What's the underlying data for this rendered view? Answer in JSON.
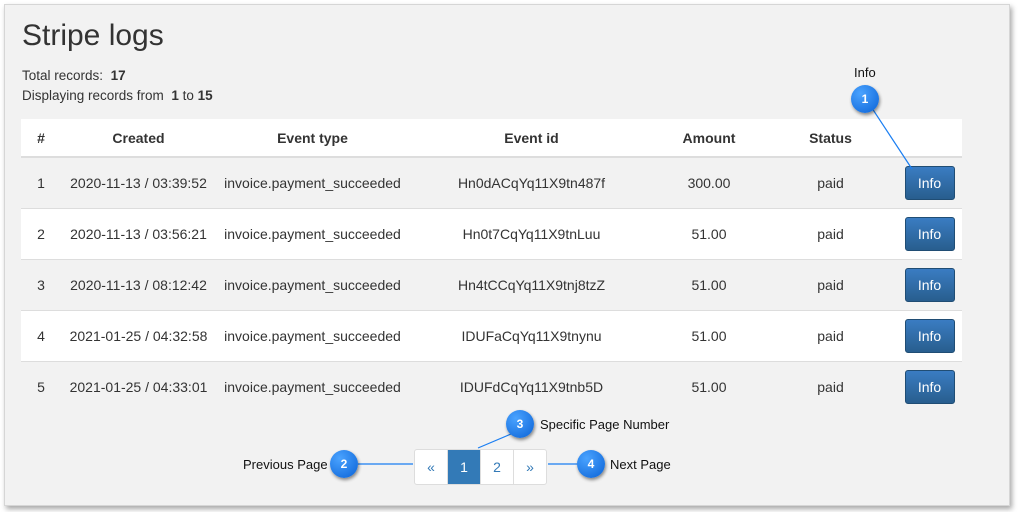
{
  "page": {
    "title": "Stripe logs",
    "total_label": "Total records:",
    "total_value": "17",
    "display_prefix": "Displaying records from",
    "display_from": "1",
    "display_to_word": "to",
    "display_to": "15"
  },
  "table": {
    "headers": [
      "#",
      "Created",
      "Event type",
      "Event id",
      "Amount",
      "Status",
      ""
    ],
    "rows": [
      {
        "num": "1",
        "created": "2020-11-13 / 03:39:52",
        "event_type": "invoice.payment_succeeded",
        "event_id": "Hn0dACqYq11X9tn487f",
        "amount": "300.00",
        "status": "paid",
        "action": "Info"
      },
      {
        "num": "2",
        "created": "2020-11-13 / 03:56:21",
        "event_type": "invoice.payment_succeeded",
        "event_id": "Hn0t7CqYq11X9tnLuu",
        "amount": "51.00",
        "status": "paid",
        "action": "Info"
      },
      {
        "num": "3",
        "created": "2020-11-13 / 08:12:42",
        "event_type": "invoice.payment_succeeded",
        "event_id": "Hn4tCCqYq11X9tnj8tzZ",
        "amount": "51.00",
        "status": "paid",
        "action": "Info"
      },
      {
        "num": "4",
        "created": "2021-01-25 / 04:32:58",
        "event_type": "invoice.payment_succeeded",
        "event_id": "IDUFaCqYq11X9tnynu",
        "amount": "51.00",
        "status": "paid",
        "action": "Info"
      },
      {
        "num": "5",
        "created": "2021-01-25 / 04:33:01",
        "event_type": "invoice.payment_succeeded",
        "event_id": "IDUFdCqYq11X9tnb5D",
        "amount": "51.00",
        "status": "paid",
        "action": "Info"
      }
    ]
  },
  "pagination": {
    "prev": "«",
    "page1": "1",
    "page2": "2",
    "next": "»"
  },
  "callouts": [
    {
      "num": "1",
      "label": "Info"
    },
    {
      "num": "2",
      "label": "Previous Page"
    },
    {
      "num": "3",
      "label": "Specific Page Number"
    },
    {
      "num": "4",
      "label": "Next Page"
    }
  ],
  "colors": {
    "accent": "#337ab7",
    "button": "#2e6da4",
    "callout": "#1a7ef2"
  }
}
